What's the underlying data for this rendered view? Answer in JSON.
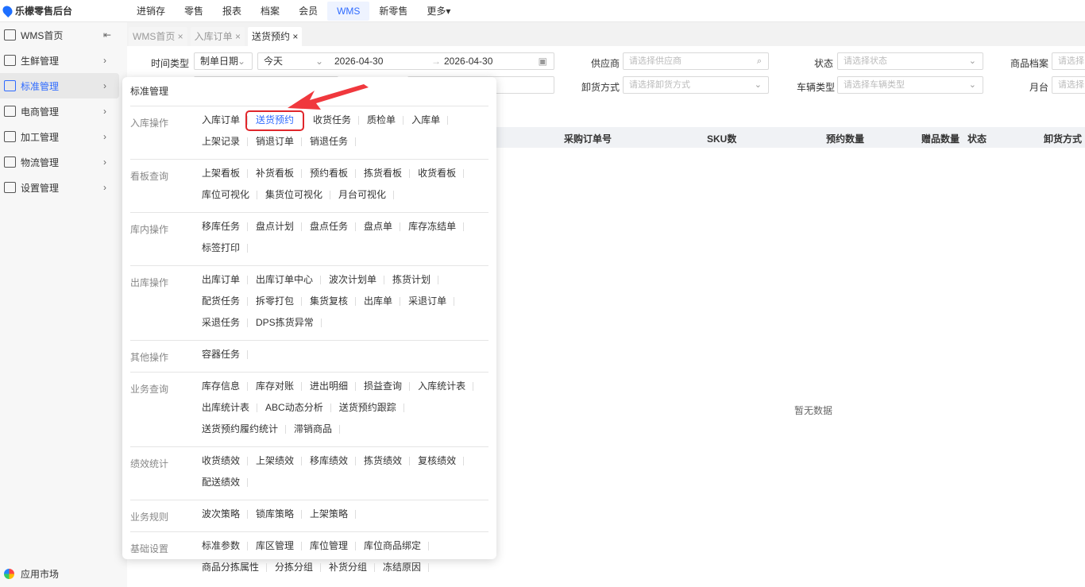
{
  "brand": "乐檬零售后台",
  "topnav": [
    "进销存",
    "零售",
    "报表",
    "档案",
    "会员",
    "WMS",
    "新零售",
    "更多▾"
  ],
  "sidebar": [
    "WMS首页",
    "生鲜管理",
    "标准管理",
    "电商管理",
    "加工管理",
    "物流管理",
    "设置管理"
  ],
  "market": "应用市场",
  "tabs": [
    "WMS首页 ×",
    "入库订单 ×",
    "送货预约 ×"
  ],
  "filters": {
    "time_type": "时间类型",
    "time_type_val": "制单日期",
    "range": "今天",
    "start": "2026-04-30",
    "end": "2026-04-30",
    "supplier": "供应商",
    "supplier_ph": "请选择供应商",
    "status": "状态",
    "status_ph": "请选择状态",
    "goods": "商品档案",
    "goods_ph": "请选择",
    "unload": "卸货方式",
    "unload_ph": "请选择卸货方式",
    "vehicle": "车辆类型",
    "vehicle_ph": "请选择车辆类型",
    "dock": "月台",
    "dock_ph": "请选择"
  },
  "columns": [
    "采购订单号",
    "SKU数",
    "预约数量",
    "赠品数量",
    "状态",
    "卸货方式"
  ],
  "empty": "暂无数据",
  "menu": {
    "title": "标准管理",
    "groups": [
      {
        "label": "入库操作",
        "items": [
          "入库订单",
          "送货预约",
          "收货任务",
          "质检单",
          "入库单",
          "上架记录",
          "销退订单",
          "销退任务"
        ]
      },
      {
        "label": "看板查询",
        "items": [
          "上架看板",
          "补货看板",
          "预约看板",
          "拣货看板",
          "收货看板",
          "库位可视化",
          "集货位可视化",
          "月台可视化"
        ]
      },
      {
        "label": "库内操作",
        "items": [
          "移库任务",
          "盘点计划",
          "盘点任务",
          "盘点单",
          "库存冻结单",
          "标签打印"
        ]
      },
      {
        "label": "出库操作",
        "items": [
          "出库订单",
          "出库订单中心",
          "波次计划单",
          "拣货计划",
          "配货任务",
          "拆零打包",
          "集货复核",
          "出库单",
          "采退订单",
          "采退任务",
          "DPS拣货异常"
        ]
      },
      {
        "label": "其他操作",
        "items": [
          "容器任务"
        ]
      },
      {
        "label": "业务查询",
        "items": [
          "库存信息",
          "库存对账",
          "进出明细",
          "损益查询",
          "入库统计表",
          "出库统计表",
          "ABC动态分析",
          "送货预约跟踪",
          "送货预约履约统计",
          "滞销商品"
        ]
      },
      {
        "label": "绩效统计",
        "items": [
          "收货绩效",
          "上架绩效",
          "移库绩效",
          "拣货绩效",
          "复核绩效",
          "配送绩效"
        ]
      },
      {
        "label": "业务规则",
        "items": [
          "波次策略",
          "锁库策略",
          "上架策略"
        ]
      },
      {
        "label": "基础设置",
        "items": [
          "标准参数",
          "库区管理",
          "库位管理",
          "库位商品绑定",
          "商品分拣属性",
          "分拣分组",
          "补货分组",
          "冻结原因"
        ]
      }
    ]
  }
}
